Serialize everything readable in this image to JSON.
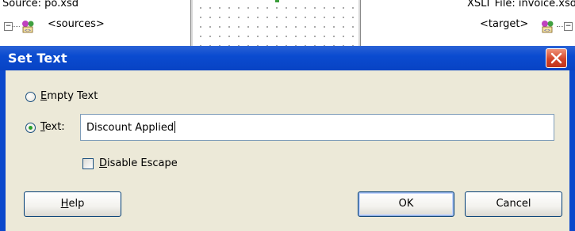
{
  "background": {
    "source_title": "Source: po.xsd",
    "xslt_title": "XSLT File: invoice.xsd",
    "source_node": "<sources>",
    "target_node": "<target>"
  },
  "dialog": {
    "title": "Set Text",
    "options": {
      "empty_text": {
        "label": "Empty Text",
        "mnemonic": "E",
        "rest": "mpty Text",
        "selected": false
      },
      "text": {
        "label": "Text:",
        "mnemonic": "T",
        "rest": "ext:",
        "selected": true
      }
    },
    "text_value": "Discount Applied",
    "disable_escape": {
      "label": "Disable Escape",
      "mnemonic": "D",
      "rest": "isable Escape",
      "checked": false
    },
    "buttons": {
      "help": {
        "label": "Help",
        "mnemonic": "H",
        "rest": "elp"
      },
      "ok": "OK",
      "cancel": "Cancel"
    }
  },
  "colors": {
    "titlebar": "#0a4bd0",
    "dialog_bg": "#ece9d8",
    "close_button": "#d3452a",
    "radio_selected": "#2aa02a"
  },
  "icons": [
    "collapse-icon",
    "schema-node-icon",
    "close-icon"
  ]
}
